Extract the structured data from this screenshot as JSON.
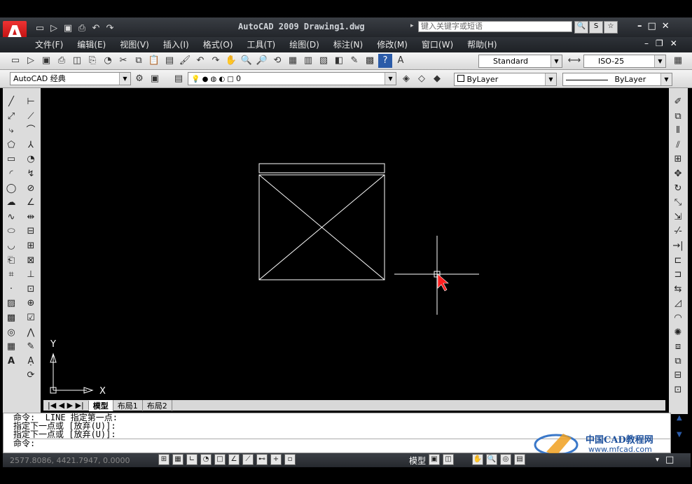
{
  "window": {
    "title": "AutoCAD 2009  Drawing1.dwg",
    "logo_letter": "A",
    "search_placeholder": "键入关键字或短语"
  },
  "menus": [
    "文件(F)",
    "编辑(E)",
    "视图(V)",
    "插入(I)",
    "格式(O)",
    "工具(T)",
    "绘图(D)",
    "标注(N)",
    "修改(M)",
    "窗口(W)",
    "帮助(H)"
  ],
  "toolbar": {
    "text_style": "Standard",
    "dim_style": "ISO-25",
    "workspace": "AutoCAD 经典",
    "layer": "0",
    "color": "ByLayer",
    "linetype": "ByLayer"
  },
  "axes": {
    "x": "X",
    "y": "Y"
  },
  "tabs": [
    "模型",
    "布局1",
    "布局2"
  ],
  "command": {
    "lines": [
      "命令:  LINE 指定第一点:",
      "指定下一点或 [放弃(U)]:",
      "指定下一点或 [放弃(U)]:",
      "命令:"
    ]
  },
  "status": {
    "coords": "2577.8086, 4421.7947, 0.0000",
    "model": "模型"
  },
  "watermark": {
    "name": "中国CAD教程网",
    "url": "www.mfcad.com"
  },
  "colors": {
    "cursor": "#ff2020",
    "geometry": "#ffffff",
    "canvas": "#000000"
  }
}
